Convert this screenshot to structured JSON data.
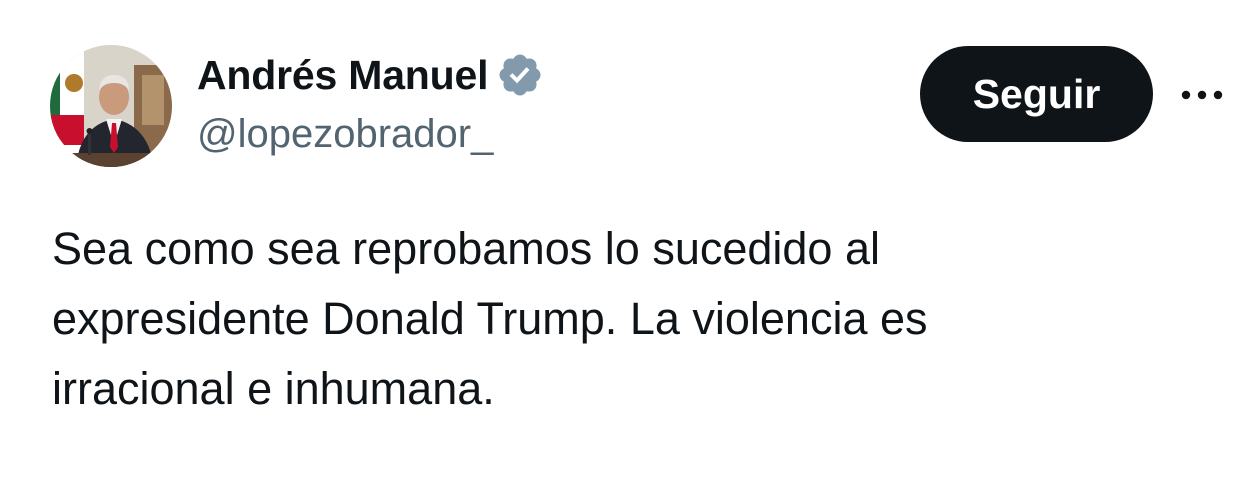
{
  "author": {
    "display_name": "Andrés Manuel",
    "handle": "@lopezobrador_",
    "verified": true,
    "verified_icon": "verified-badge-icon",
    "verified_color": "#829aab"
  },
  "actions": {
    "follow_label": "Seguir",
    "more_icon": "more-options-icon"
  },
  "tweet": {
    "text": "Sea como sea reprobamos lo sucedido al\nexpresidente Donald Trump. La violencia es\nirracional e inhumana."
  },
  "colors": {
    "text_primary": "#0f1419",
    "text_secondary": "#536471",
    "button_bg": "#0f1419",
    "button_text": "#ffffff"
  }
}
